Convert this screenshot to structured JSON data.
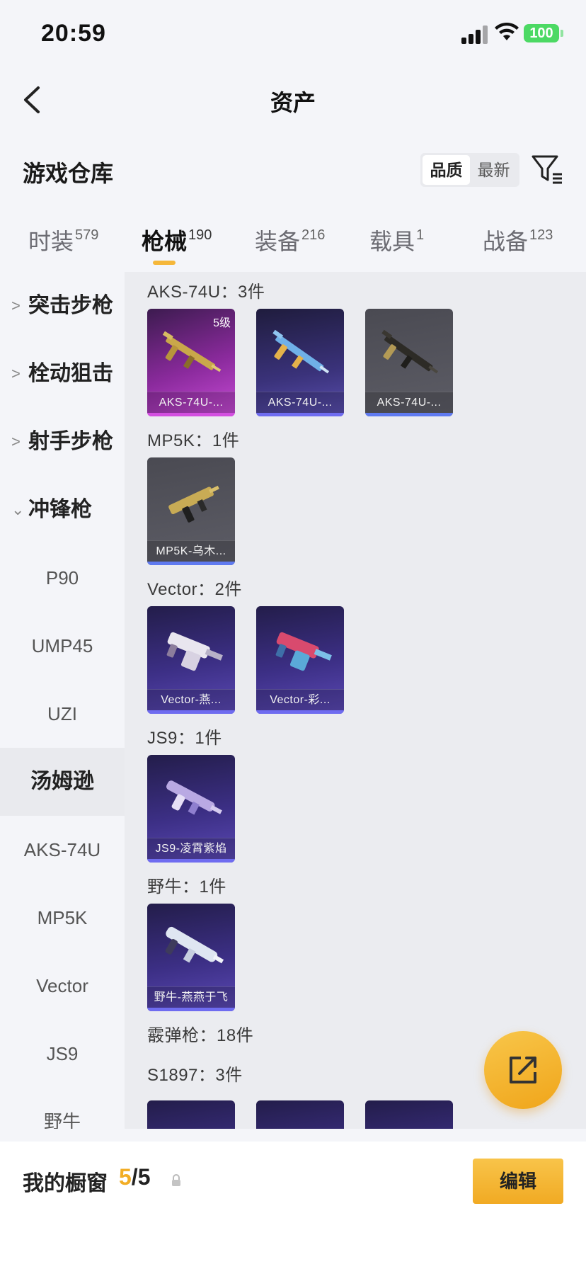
{
  "status_bar": {
    "time": "20:59",
    "battery": "100"
  },
  "nav": {
    "title": "资产"
  },
  "warehouse": {
    "title": "游戏仓库",
    "sort_options": [
      "品质",
      "最新"
    ]
  },
  "tabs": [
    {
      "label": "时装",
      "count": "579"
    },
    {
      "label": "枪械",
      "count": "190"
    },
    {
      "label": "装备",
      "count": "216"
    },
    {
      "label": "载具",
      "count": "1"
    },
    {
      "label": "战备",
      "count": "123"
    }
  ],
  "sidebar": {
    "categories": [
      "突击步枪",
      "栓动狙击",
      "射手步枪",
      "冲锋枪"
    ],
    "subitems": [
      "P90",
      "UMP45",
      "UZI",
      "汤姆逊",
      "AKS-74U",
      "MP5K",
      "Vector",
      "JS9",
      "野牛"
    ],
    "selected": "汤姆逊"
  },
  "groups": [
    {
      "title": "AKS-74U：3件",
      "items": [
        {
          "label": "AKS-74U-...",
          "level": "5级"
        },
        {
          "label": "AKS-74U-..."
        },
        {
          "label": "AKS-74U-..."
        }
      ]
    },
    {
      "title": "MP5K：1件",
      "items": [
        {
          "label": "MP5K-乌木..."
        }
      ]
    },
    {
      "title": "Vector：2件",
      "items": [
        {
          "label": "Vector-燕..."
        },
        {
          "label": "Vector-彩..."
        }
      ]
    },
    {
      "title": "JS9：1件",
      "items": [
        {
          "label": "JS9-凌霄紫焰"
        }
      ]
    },
    {
      "title": "野牛：1件",
      "items": [
        {
          "label": "野牛-燕燕于飞"
        }
      ]
    },
    {
      "title": "霰弹枪：18件"
    },
    {
      "title": "S1897：3件"
    }
  ],
  "bottom": {
    "title": "我的橱窗",
    "current": "5",
    "total": "/5",
    "edit_label": "编辑"
  },
  "colors": {
    "accent": "#f2ad24",
    "rarity_purple": "#6f6cf0",
    "rarity_pink": "#d34fe0"
  }
}
